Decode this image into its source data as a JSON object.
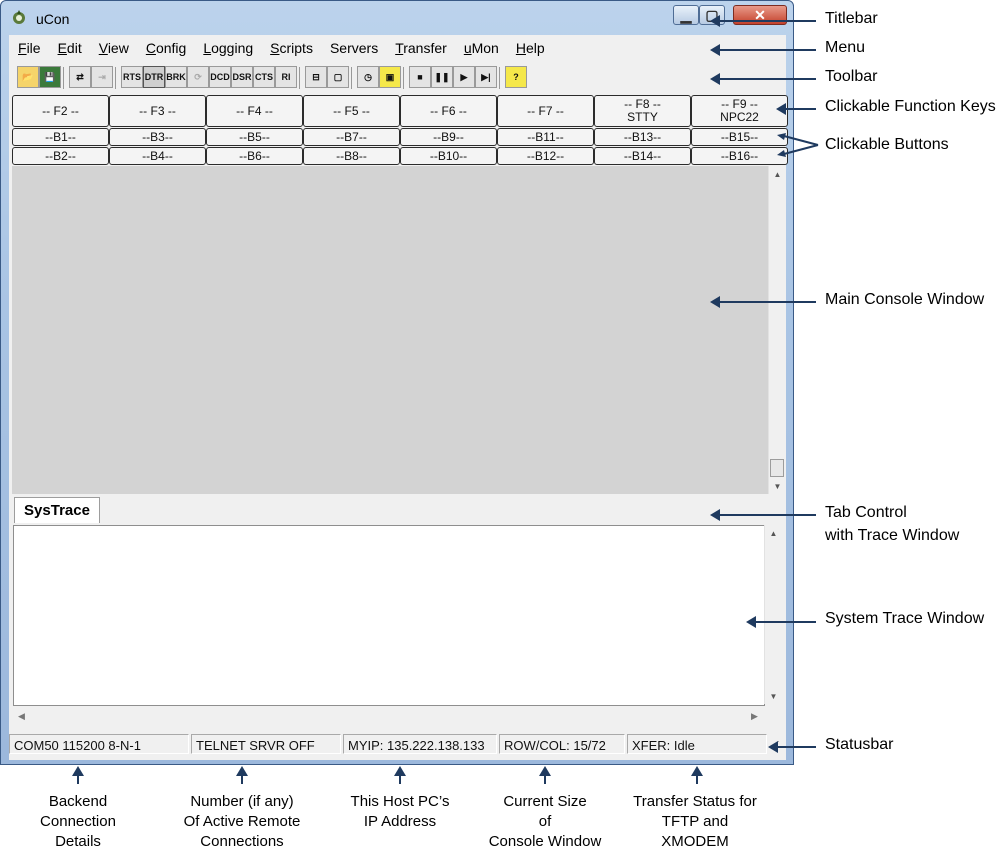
{
  "window": {
    "title": "uCon",
    "app_icon": "ucon-app-icon",
    "close_glyph": "✕",
    "min_glyph": "▁",
    "max_glyph": "▢"
  },
  "menu": [
    {
      "mn": "F",
      "rest": "ile"
    },
    {
      "mn": "E",
      "rest": "dit"
    },
    {
      "mn": "V",
      "rest": "iew"
    },
    {
      "mn": "C",
      "rest": "onfig"
    },
    {
      "mn": "L",
      "rest": "ogging"
    },
    {
      "mn": "S",
      "rest": "cripts"
    },
    {
      "mn": "",
      "rest": "Servers"
    },
    {
      "mn": "T",
      "rest": "ransfer"
    },
    {
      "mn": "u",
      "rest": "Mon"
    },
    {
      "mn": "H",
      "rest": "elp"
    }
  ],
  "toolbar": {
    "icons": [
      {
        "name": "open-folder-icon",
        "glyph": "📂"
      },
      {
        "name": "save-disk-icon",
        "glyph": "💾"
      },
      {
        "name": "connect-icon",
        "glyph": "⇄"
      },
      {
        "name": "disconnect-icon",
        "glyph": "⇥"
      },
      {
        "name": "rts-icon",
        "glyph": "RTS"
      },
      {
        "name": "dtr-icon",
        "glyph": "DTR"
      },
      {
        "name": "brk-icon",
        "glyph": "BRK"
      },
      {
        "name": "loop-icon",
        "glyph": "⟳"
      },
      {
        "name": "dcd-icon",
        "glyph": "DCD"
      },
      {
        "name": "dsr-icon",
        "glyph": "DSR"
      },
      {
        "name": "cts-icon",
        "glyph": "CTS"
      },
      {
        "name": "ri-icon",
        "glyph": "RI"
      },
      {
        "name": "split-view-icon",
        "glyph": "⊟"
      },
      {
        "name": "single-view-icon",
        "glyph": "▢"
      },
      {
        "name": "clock-icon",
        "glyph": "◷"
      },
      {
        "name": "script-folder-icon",
        "glyph": "▣"
      },
      {
        "name": "stop-icon",
        "glyph": "■"
      },
      {
        "name": "pause-icon",
        "glyph": "❚❚"
      },
      {
        "name": "play-icon",
        "glyph": "▶"
      },
      {
        "name": "step-icon",
        "glyph": "▶|"
      },
      {
        "name": "help-icon",
        "glyph": "?"
      }
    ]
  },
  "function_keys": [
    {
      "line1": "-- F2 --",
      "line2": ""
    },
    {
      "line1": "-- F3 --",
      "line2": ""
    },
    {
      "line1": "-- F4 --",
      "line2": ""
    },
    {
      "line1": "-- F5 --",
      "line2": ""
    },
    {
      "line1": "-- F6 --",
      "line2": ""
    },
    {
      "line1": "-- F7 --",
      "line2": ""
    },
    {
      "line1": "-- F8 --",
      "line2": "STTY"
    },
    {
      "line1": "-- F9 --",
      "line2": "NPC22"
    }
  ],
  "buttons_row1": [
    "--B1--",
    "--B3--",
    "--B5--",
    "--B7--",
    "--B9--",
    "--B11--",
    "--B13--",
    "--B15--"
  ],
  "buttons_row2": [
    "--B2--",
    "--B4--",
    "--B6--",
    "--B8--",
    "--B10--",
    "--B12--",
    "--B14--",
    "--B16--"
  ],
  "tabs": [
    {
      "label": "SysTrace"
    }
  ],
  "statusbar": [
    "COM50 115200 8-N-1",
    "TELNET SRVR OFF",
    "MYIP: 135.222.138.133",
    "ROW/COL: 15/72",
    "XFER: Idle"
  ],
  "annotations": {
    "titlebar": "Titlebar",
    "menu": "Menu",
    "toolbar": "Toolbar",
    "function_keys": "Clickable Function Keys",
    "buttons": "Clickable Buttons",
    "console": "Main Console Window",
    "tab_line1": "Tab Control",
    "tab_line2": "with Trace Window",
    "trace": "System Trace Window",
    "statusbar": "Statusbar",
    "bottom": [
      [
        "Backend",
        "Connection",
        "Details"
      ],
      [
        "Number (if any)",
        "Of Active Remote",
        "Connections"
      ],
      [
        "This Host PC’s",
        "IP Address"
      ],
      [
        "Current Size",
        "of",
        "Console Window"
      ],
      [
        "Transfer Status for",
        "TFTP and",
        "XMODEM"
      ]
    ]
  },
  "colors": {
    "arrow": "#1f3a5f",
    "console_bg": "#d3d3d3",
    "frame": "#a9c4e4"
  }
}
